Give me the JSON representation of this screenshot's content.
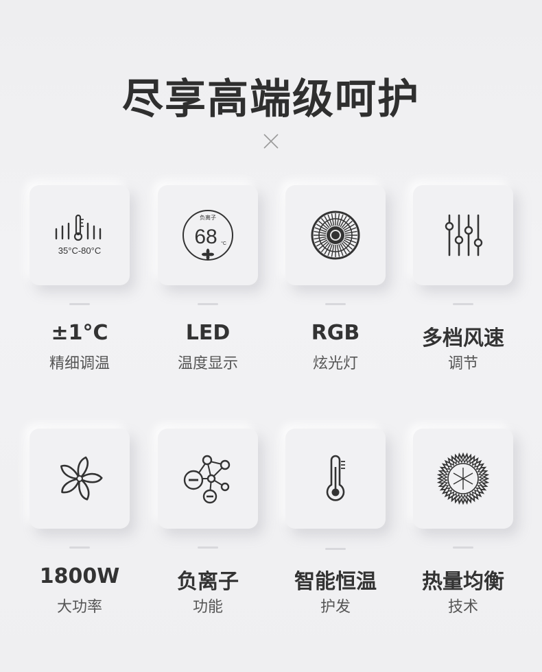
{
  "header": {
    "title": "尽享高端级呵护"
  },
  "features": [
    {
      "icon": "thermometer-bars-icon",
      "title": "±1°C",
      "subtitle": "精细调温",
      "icon_text": "35°C-80°C"
    },
    {
      "icon": "led-display-icon",
      "title": "LED",
      "subtitle": "温度显示",
      "icon_text_top": "负离子",
      "icon_text_value": "68",
      "icon_text_unit": "°C"
    },
    {
      "icon": "rgb-fan-grille-icon",
      "title": "RGB",
      "subtitle": "炫光灯"
    },
    {
      "icon": "sliders-icon",
      "title": "多档风速",
      "subtitle": "调节"
    },
    {
      "icon": "fan-blades-icon",
      "title": "1800W",
      "subtitle": "大功率"
    },
    {
      "icon": "negative-ion-icon",
      "title": "负离子",
      "subtitle": "功能"
    },
    {
      "icon": "thermometer-icon",
      "title": "智能恒温",
      "subtitle": "护发"
    },
    {
      "icon": "heat-burst-icon",
      "title": "热量均衡",
      "subtitle": "技术"
    }
  ]
}
